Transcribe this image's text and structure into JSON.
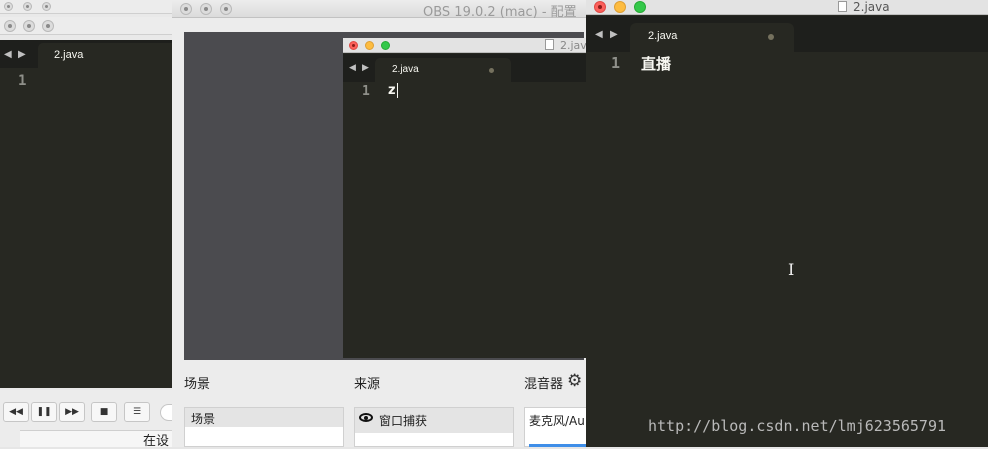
{
  "obs": {
    "title": "OBS 19.0.2 (mac) - 配置",
    "scenes_label": "场景",
    "sources_label": "来源",
    "mixer_label": "混音器",
    "scene_item": "场景",
    "source_item": "窗口捕获",
    "mixer_item": "麦克风/Au"
  },
  "left_editor": {
    "tab": "2.java",
    "line": "1"
  },
  "middle_editor": {
    "file": "2.java",
    "tab": "2.java",
    "line": "1",
    "code": "z"
  },
  "right_editor": {
    "title": "2.java",
    "tab": "2.java",
    "line": "1",
    "code": "直播"
  },
  "player": {
    "rewind": "◀◀",
    "pause": "❚❚",
    "forward": "▶▶",
    "stop": "■",
    "list": "☰",
    "status": "在设"
  },
  "watermark": "http://blog.csdn.net/lmj623565791"
}
